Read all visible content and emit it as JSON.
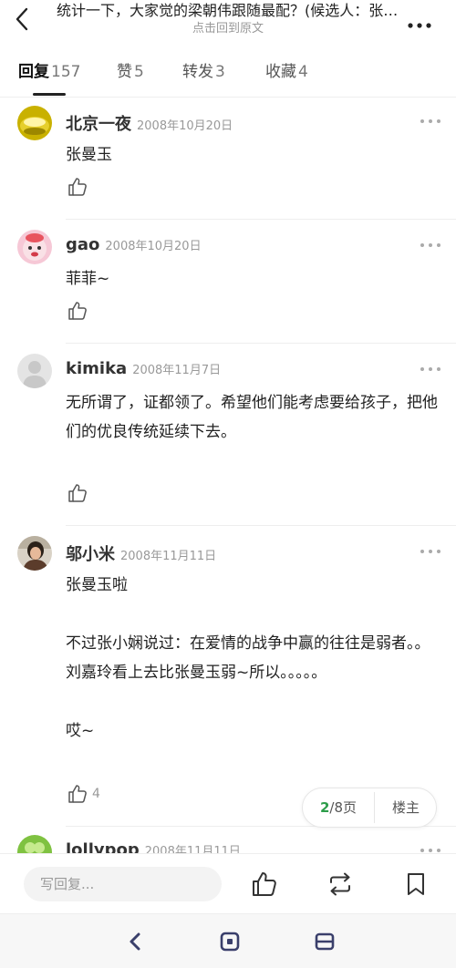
{
  "header": {
    "title": "统计一下，大家觉的梁朝伟跟随最配？(候选人：张…",
    "subtitle": "点击回到原文"
  },
  "tabs": [
    {
      "label": "回复",
      "count": "157"
    },
    {
      "label": "赞",
      "count": "5"
    },
    {
      "label": "转发",
      "count": "3"
    },
    {
      "label": "收藏",
      "count": "4"
    }
  ],
  "comments": [
    {
      "user": "北京一夜",
      "date": "2008年10月20日",
      "text": "张曼玉",
      "likes": ""
    },
    {
      "user": "gao",
      "date": "2008年10月20日",
      "text": "菲菲~",
      "likes": ""
    },
    {
      "user": "kimika",
      "date": "2008年11月7日",
      "text": "无所谓了，证都领了。希望他们能考虑要给孩子，把他们的优良传统延续下去。",
      "likes": ""
    },
    {
      "user": "邬小米",
      "date": "2008年11月11日",
      "text": "张曼玉啦\n\n不过张小娴说过：在爱情的战争中赢的往往是弱者。。\n刘嘉玲看上去比张曼玉弱~所以。。。。。\n\n哎~",
      "likes": "4"
    },
    {
      "user": "lollypop",
      "date": "2008年11月11日",
      "text": "",
      "likes": ""
    }
  ],
  "pagination": {
    "current": "2",
    "total": "/8页",
    "op_label": "楼主"
  },
  "bottom": {
    "reply_placeholder": "写回复..."
  },
  "icons": {
    "back": "chevron-left-icon",
    "more": "more-dots-icon",
    "like": "thumbs-up-icon",
    "repost": "repost-icon",
    "bookmark": "bookmark-icon"
  },
  "colors": {
    "page_current": "#2d9d4a",
    "text": "#222222",
    "muted": "#999999"
  }
}
